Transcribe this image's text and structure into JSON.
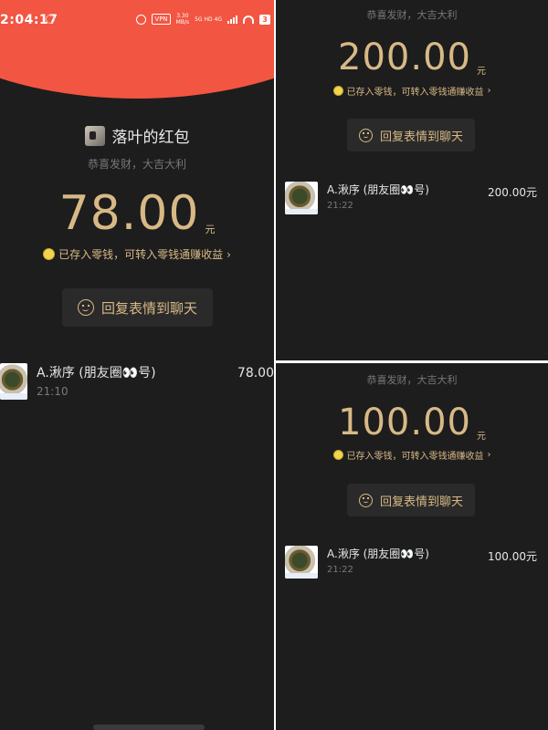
{
  "left": {
    "status_bar": {
      "time": "2:04:17",
      "vpn": "VPN",
      "speed": "3.30\nMB/s",
      "net": "5G HD 4G",
      "battery": "3"
    },
    "sender": "落叶的红包",
    "greeting": "恭喜发财，大吉大利",
    "amount": "78.00",
    "unit": "元",
    "saved_note": "已存入零钱，可转入零钱通赚收益",
    "reply_label": "回复表情到聊天",
    "receiver": {
      "name": "A.湫序 (朋友圈👀号)",
      "time": "21:10",
      "amount": "78.00"
    }
  },
  "right_top": {
    "greeting": "恭喜发财，大吉大利",
    "amount": "200.00",
    "unit": "元",
    "saved_note": "已存入零钱，可转入零钱通赚收益",
    "reply_label": "回复表情到聊天",
    "receiver": {
      "name": "A.湫序 (朋友圈👀号)",
      "time": "21:22",
      "amount": "200.00元"
    }
  },
  "right_bottom": {
    "greeting": "恭喜发财，大吉大利",
    "amount": "100.00",
    "unit": "元",
    "saved_note": "已存入零钱，可转入零钱通赚收益",
    "reply_label": "回复表情到聊天",
    "receiver": {
      "name": "A.湫序 (朋友圈👀号)",
      "time": "21:22",
      "amount": "100.00元"
    }
  },
  "colors": {
    "background": "#1d1d1d",
    "header_red": "#f25542",
    "gold": "#d8b986",
    "muted": "#777777"
  },
  "icons": [
    "alarm-icon",
    "wifi-icon",
    "battery-icon",
    "coin-icon",
    "smile-icon",
    "chevron-right-icon",
    "avatar"
  ]
}
